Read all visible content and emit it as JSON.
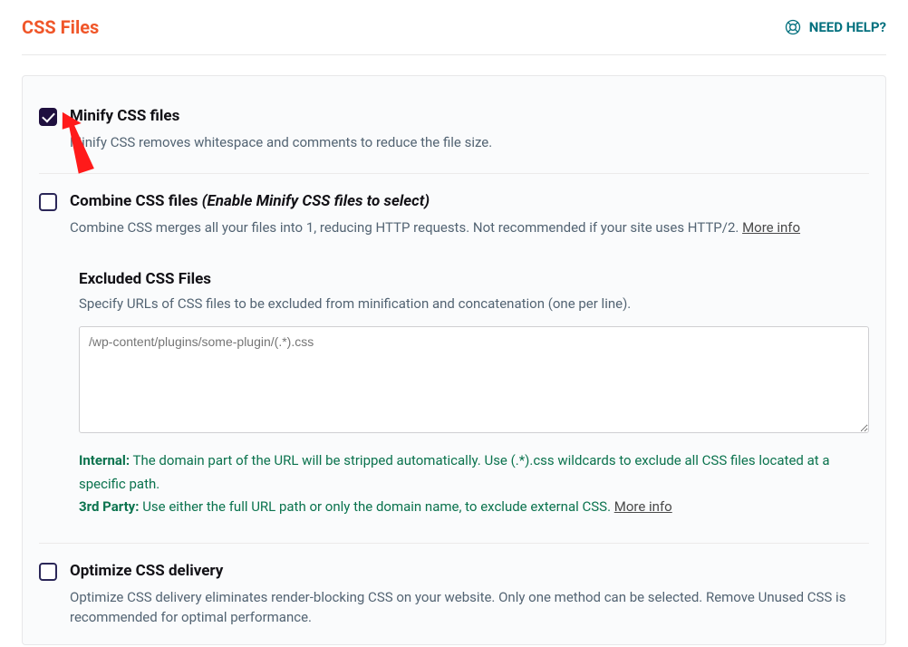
{
  "header": {
    "title": "CSS Files",
    "help": "NEED HELP?"
  },
  "options": {
    "minify": {
      "title": "Minify CSS files",
      "desc": "Minify CSS removes whitespace and comments to reduce the file size."
    },
    "combine": {
      "title": "Combine CSS files",
      "note": "(Enable Minify CSS files to select)",
      "desc_before": "Combine CSS merges all your files into 1, reducing HTTP requests. Not recommended if your site uses HTTP/2. ",
      "more": "More info"
    },
    "excluded": {
      "title": "Excluded CSS Files",
      "desc": "Specify URLs of CSS files to be excluded from minification and concatenation (one per line).",
      "placeholder": "/wp-content/plugins/some-plugin/(.*).css",
      "hint_internal_label": "Internal:",
      "hint_internal_text": " The domain part of the URL will be stripped automatically. Use (.*).css wildcards to exclude all CSS files located at a specific path.",
      "hint_3rd_label": "3rd Party:",
      "hint_3rd_text": " Use either the full URL path or only the domain name, to exclude external CSS. ",
      "more": "More info"
    },
    "optimize": {
      "title": "Optimize CSS delivery",
      "desc": "Optimize CSS delivery eliminates render-blocking CSS on your website. Only one method can be selected. Remove Unused CSS is recommended for optimal performance."
    }
  }
}
